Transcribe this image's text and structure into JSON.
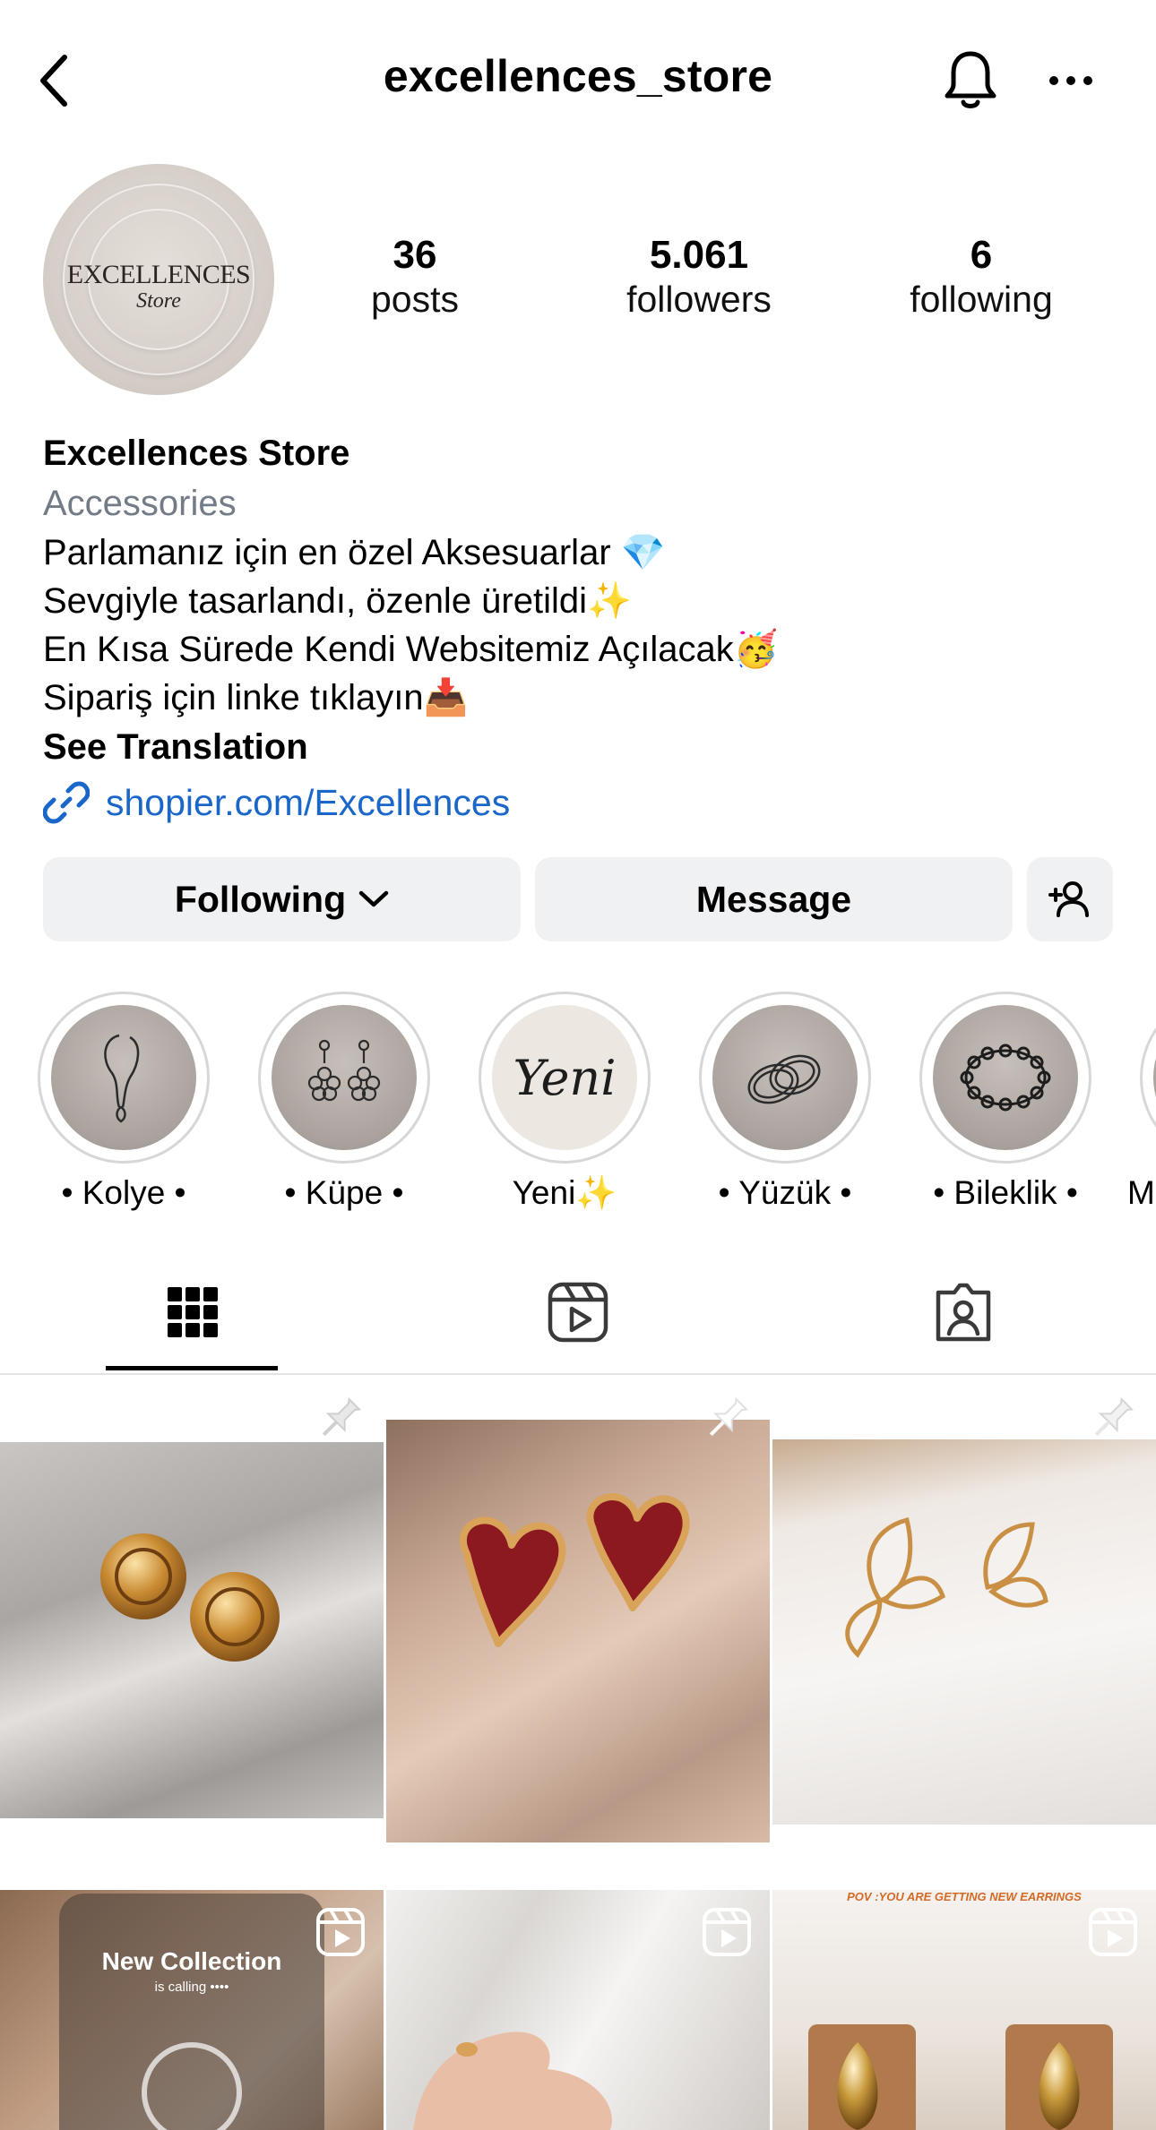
{
  "header": {
    "username": "excellences_store",
    "back_icon": "chevron-left-icon",
    "bell_icon": "bell-icon",
    "more_icon": "more-dots-icon"
  },
  "avatar": {
    "logo_line1": "EXCELLENCES",
    "logo_line2": "Store"
  },
  "stats": [
    {
      "value": "36",
      "label": "posts"
    },
    {
      "value": "5.061",
      "label": "followers"
    },
    {
      "value": "6",
      "label": "following"
    }
  ],
  "bio": {
    "name": "Excellences Store",
    "category": "Accessories",
    "lines": [
      "Parlamanız için en özel Aksesuarlar 💎",
      "Sevgiyle tasarlandı, özenle üretildi✨",
      "En Kısa Sürede Kendi Websitemiz Açılacak🥳",
      "Sipariş için linke tıklayın📥"
    ],
    "see_translation": "See Translation",
    "link": "shopier.com/Excellences"
  },
  "actions": {
    "following_label": "Following",
    "message_label": "Message",
    "add_user_icon": "add-user-icon"
  },
  "highlights": [
    {
      "label": "• Kolye •",
      "icon": "necklace-icon"
    },
    {
      "label": "• Küpe •",
      "icon": "earrings-icon"
    },
    {
      "label": "Yeni✨",
      "icon": "yeni-script",
      "script_text": "Yeni"
    },
    {
      "label": "• Yüzük •",
      "icon": "rings-icon"
    },
    {
      "label": "• Bileklik •",
      "icon": "bracelet-icon"
    },
    {
      "label": "M",
      "icon": "partial-highlight"
    }
  ],
  "tabs": [
    {
      "name": "grid",
      "icon": "grid-icon",
      "active": true
    },
    {
      "name": "reels",
      "icon": "reels-icon",
      "active": false
    },
    {
      "name": "tagged",
      "icon": "tagged-icon",
      "active": false
    }
  ],
  "posts": [
    {
      "type": "image",
      "pinned": true,
      "subject": "gold knot earrings"
    },
    {
      "type": "image",
      "pinned": true,
      "subject": "red heart earrings"
    },
    {
      "type": "image",
      "pinned": true,
      "subject": "butterfly earrings"
    },
    {
      "type": "reel",
      "title": "New Collection",
      "subtitle": "is calling ••••"
    },
    {
      "type": "reel",
      "subject": "hand with ring"
    },
    {
      "type": "reel",
      "caption": "POV :YOU ARE GETTING NEW EARRINGS"
    }
  ],
  "colors": {
    "link_blue": "#1a66c9",
    "button_bg": "#eff1f3",
    "secondary_text": "#737b86"
  }
}
